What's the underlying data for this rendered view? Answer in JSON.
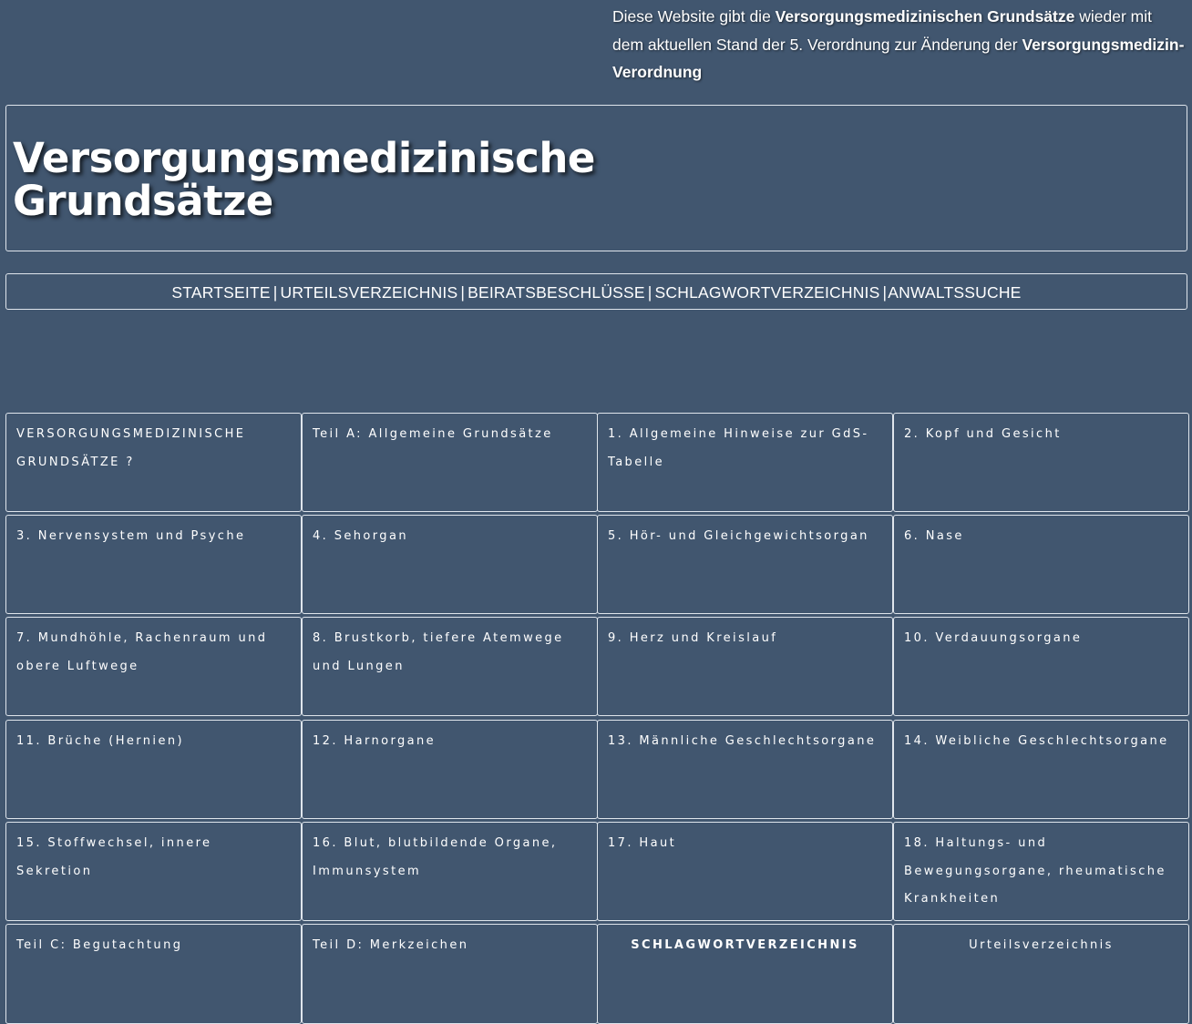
{
  "intro": {
    "part1": "Diese Website gibt die ",
    "bold1": "Versorgungsmedizinischen Grundsätze",
    "part2": " wieder mit dem aktuellen Stand der 5. Verordnung zur Änderung der ",
    "bold2": "Versorgungsmedizin-Verordnung"
  },
  "header": {
    "title_line1": "Versorgungsmedizinische",
    "title_line2": "Grundsätze"
  },
  "nav": {
    "items": [
      "STARTSEITE",
      "URTEILSVERZEICHNIS",
      "BEIRATSBESCHLÜSSE",
      "SCHLAGWORTVERZEICHNIS",
      "ANWALTSSUCHE"
    ],
    "separator": "|"
  },
  "tiles": [
    "VERSORGUNGSMEDIZINISCHE GRUNDSÄTZE ?",
    "Teil A: Allgemeine Grundsätze",
    "1. Allgemeine Hinweise zur GdS-Tabelle",
    "2. Kopf und Gesicht",
    "3. Nervensystem und Psyche",
    "4. Sehorgan",
    "5. Hör- und Gleichgewichtsorgan",
    "6. Nase",
    "7. Mundhöhle, Rachenraum und obere Luftwege",
    "8. Brustkorb, tiefere Atemwege und Lungen",
    "9. Herz und Kreislauf",
    "10. Verdauungsorgane",
    "11. Brüche (Hernien)",
    "12. Harnorgane",
    "13. Männliche Geschlechtsorgane",
    "14. Weibliche Geschlechtsorgane",
    "15. Stoffwechsel, innere Sekretion",
    "16. Blut, blutbildende Organe, Immunsystem",
    "17. Haut",
    "18. Haltungs- und Bewegungsorgane, rheumatische Krankheiten",
    "Teil C: Begutachtung",
    "Teil D: Merkzeichen",
    "SCHLAGWORTVERZEICHNIS",
    "Urteilsverzeichnis"
  ]
}
